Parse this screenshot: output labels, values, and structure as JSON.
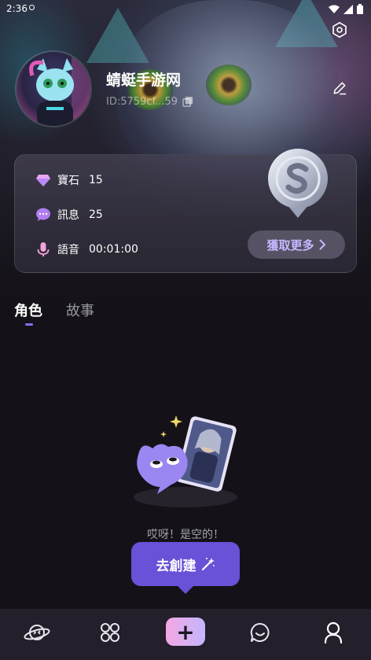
{
  "status_bar": {
    "time": "2:36"
  },
  "colors": {
    "accent": "#6a51d8",
    "tab_indicator": "#8b6df6",
    "get_more_text": "#c7b6ff",
    "nav_bg": "#231f2b",
    "page_bg": "#141218"
  },
  "profile": {
    "name": "蜻蜓手游网",
    "id": "ID:5759cf...59",
    "icons": [
      "settings-icon",
      "edit-icon",
      "copy-icon"
    ]
  },
  "wallet": {
    "gems_label": "寶石",
    "gems_value": "15",
    "messages_label": "訊息",
    "messages_value": "25",
    "voice_label": "語音",
    "voice_value": "00:01:00",
    "get_more_label": "獲取更多"
  },
  "tabs": {
    "characters": "角色",
    "stories": "故事",
    "active": "角色"
  },
  "empty_state": {
    "message": "哎呀！是空的！",
    "create_label": "去創建"
  },
  "bottom_nav": {
    "items": [
      "planet-icon",
      "grid-icon",
      "plus-icon",
      "chat-icon",
      "profile-icon"
    ],
    "plus_glyph": "+"
  }
}
